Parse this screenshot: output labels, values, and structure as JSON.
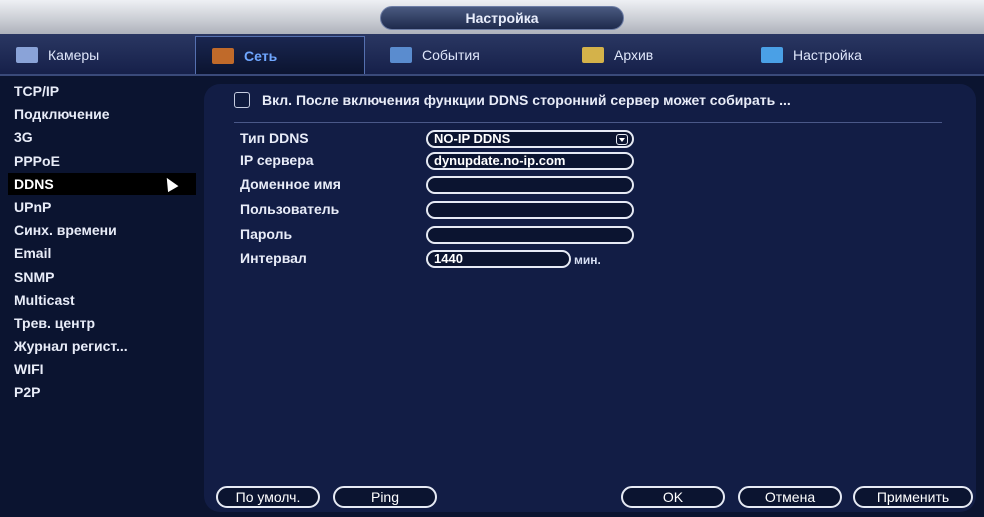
{
  "window": {
    "title": "Настройка"
  },
  "tabs": [
    {
      "label": "Камеры",
      "icon": "camera-icon",
      "color": "#8aa3d8"
    },
    {
      "label": "Сеть",
      "icon": "network-icon",
      "color": "#c06a2a"
    },
    {
      "label": "События",
      "icon": "events-icon",
      "color": "#5a8ccf"
    },
    {
      "label": "Архив",
      "icon": "archive-icon",
      "color": "#d4b24a"
    },
    {
      "label": "Настройка",
      "icon": "settings-icon",
      "color": "#4aa0e6"
    }
  ],
  "sidebar": {
    "items": [
      {
        "label": "TCP/IP"
      },
      {
        "label": "Подключение"
      },
      {
        "label": "3G"
      },
      {
        "label": "PPPoE"
      },
      {
        "label": "DDNS"
      },
      {
        "label": "UPnP"
      },
      {
        "label": "Синх. времени"
      },
      {
        "label": "Email"
      },
      {
        "label": "SNMP"
      },
      {
        "label": "Multicast"
      },
      {
        "label": "Трев. центр"
      },
      {
        "label": "Журнал регист..."
      },
      {
        "label": "WIFI"
      },
      {
        "label": "P2P"
      }
    ],
    "active": "DDNS"
  },
  "ddns": {
    "enable_text": "Вкл. После включения функции DDNS сторонний сервер может собирать ...",
    "enabled": false,
    "fields": {
      "type": {
        "label": "Тип DDNS",
        "value": "NO-IP DDNS"
      },
      "server": {
        "label": "IP сервера",
        "value": "dynupdate.no-ip.com"
      },
      "domain": {
        "label": "Доменное имя",
        "value": ""
      },
      "user": {
        "label": "Пользователь",
        "value": ""
      },
      "password": {
        "label": "Пароль",
        "value": ""
      },
      "interval": {
        "label": "Интервал",
        "value": "1440",
        "unit": "мин."
      }
    }
  },
  "buttons": {
    "default": "По умолч.",
    "ping": "Ping",
    "ok": "OK",
    "cancel": "Отмена",
    "apply": "Применить"
  },
  "colors": {
    "accent": "#6fa7ff",
    "background": "#0b1430",
    "panel": "#121d45"
  }
}
